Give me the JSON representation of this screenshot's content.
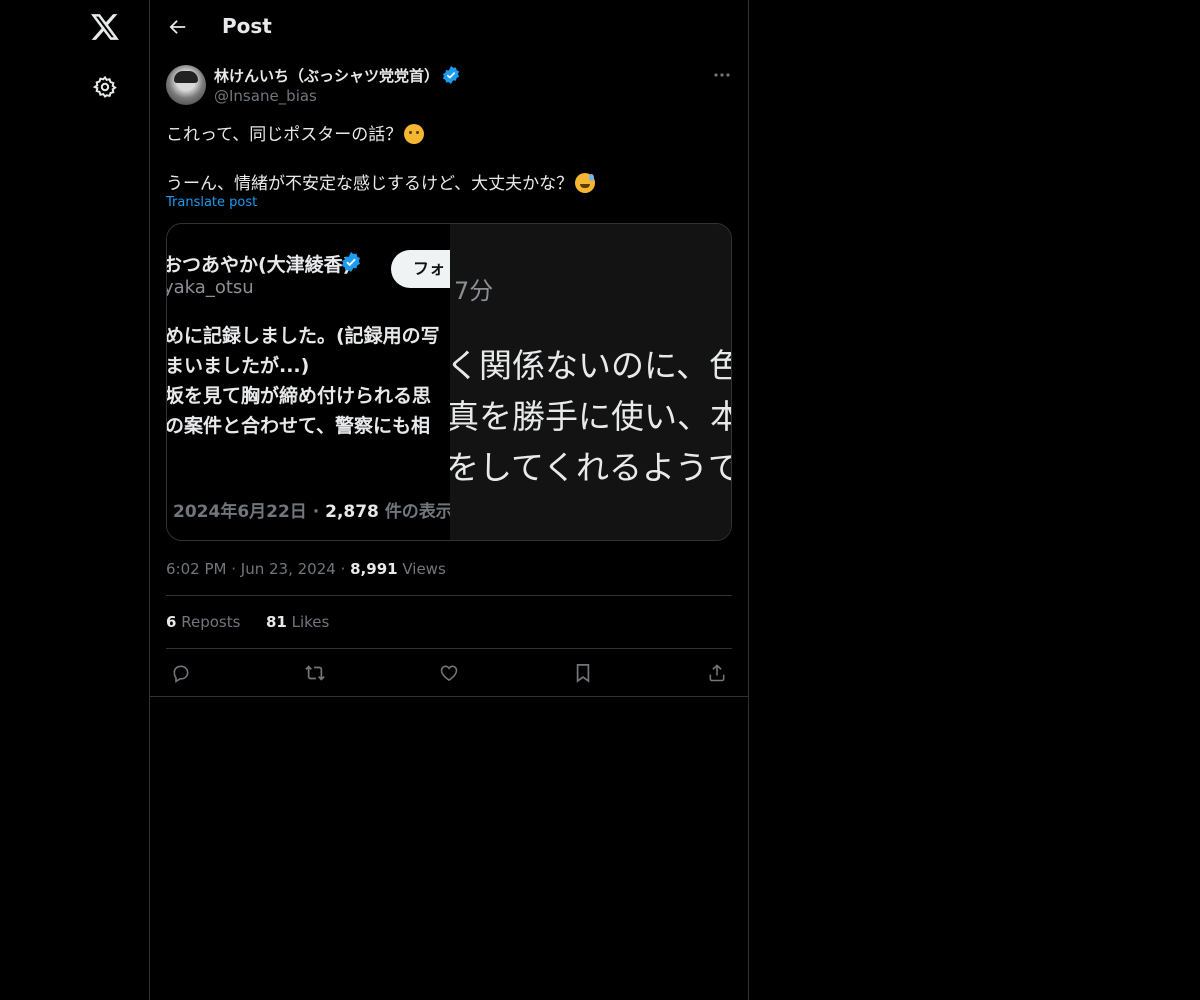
{
  "header": {
    "title": "Post"
  },
  "icons": {
    "logo": "x-logo-icon",
    "settings": "gear-icon",
    "back": "arrow-left-icon",
    "more": "more-horizontal-icon",
    "verified": "verified-badge-icon",
    "reply": "reply-icon",
    "repost": "repost-icon",
    "like": "heart-icon",
    "bookmark": "bookmark-icon",
    "share": "share-icon"
  },
  "colors": {
    "accent": "#1d9bf0",
    "background": "#000000",
    "text": "#e7e9ea",
    "muted": "#71767b",
    "border": "#2f3336"
  },
  "post": {
    "author_name": "林けんいち（ぶっシャツ党党首）",
    "author_handle": "@Insane_bias",
    "lines": [
      "これって、同じポスターの話？",
      "うーん、情緒が不安定な感じするけど、大丈夫かな？"
    ],
    "translate_label": "Translate post",
    "time": "6:02 PM",
    "date": "Jun 23, 2024",
    "views_count": "8,991",
    "views_label": "Views",
    "reposts_count": "6",
    "reposts_label": "Reposts",
    "likes_count": "81",
    "likes_label": "Likes"
  },
  "media": {
    "left": {
      "name": "おつあやか(大津綾香)",
      "follow": "フォ",
      "handle": "yaka_otsu",
      "body_lines": [
        "めに記録しました。(記録用の写",
        "まいましたが...)",
        "坂を見て胸が締め付けられる思",
        "の案件と合わせて、警察にも相"
      ],
      "date": "2024年6月22日",
      "views_count": "2,878",
      "views_label": "件の表示"
    },
    "right": {
      "time": "7分",
      "lines": [
        "く関係ないのに、色",
        "真を勝手に使い、本",
        "をしてくれるようで"
      ]
    }
  }
}
